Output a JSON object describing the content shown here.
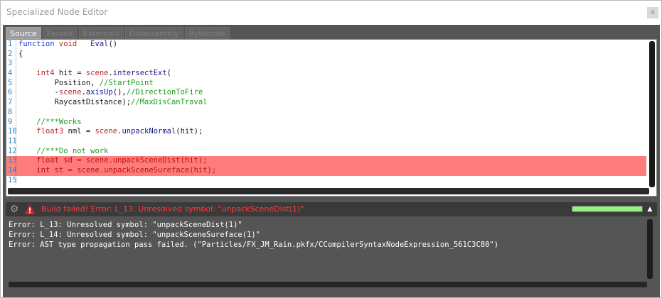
{
  "window": {
    "title": "Specialized Node Editor",
    "close_glyph": "x"
  },
  "tabs": [
    "Source",
    "Parsed",
    "Externals",
    "Disassembly",
    "Bytecode"
  ],
  "active_tab": "Source",
  "editor": {
    "lines": [
      {
        "n": "1",
        "tokens": [
          [
            "kw",
            "function "
          ],
          [
            "ty",
            "void"
          ],
          [
            "tx",
            "   "
          ],
          [
            "fn",
            "Eval"
          ],
          [
            "tx",
            "()"
          ]
        ]
      },
      {
        "n": "2",
        "tokens": [
          [
            "tx",
            "{"
          ]
        ]
      },
      {
        "n": "3",
        "tokens": []
      },
      {
        "n": "4",
        "tokens": [
          [
            "tx",
            "    "
          ],
          [
            "ty",
            "int4"
          ],
          [
            "tx",
            " hit = "
          ],
          [
            "ty",
            "scene"
          ],
          [
            "tx",
            "."
          ],
          [
            "fn",
            "intersectExt"
          ],
          [
            "tx",
            "("
          ]
        ]
      },
      {
        "n": "5",
        "tokens": [
          [
            "tx",
            "        Position, "
          ],
          [
            "cm",
            "//StartPoint"
          ]
        ]
      },
      {
        "n": "6",
        "tokens": [
          [
            "tx",
            "        -"
          ],
          [
            "ty",
            "scene"
          ],
          [
            "tx",
            "."
          ],
          [
            "fn",
            "axisUp"
          ],
          [
            "tx",
            "(),"
          ],
          [
            "cm",
            "//DirectionToFire"
          ]
        ]
      },
      {
        "n": "7",
        "tokens": [
          [
            "tx",
            "        RaycastDistance);"
          ],
          [
            "cm",
            "//MaxDisCanTraval"
          ]
        ]
      },
      {
        "n": "8",
        "tokens": []
      },
      {
        "n": "9",
        "tokens": [
          [
            "tx",
            "    "
          ],
          [
            "cm",
            "//***Works"
          ]
        ]
      },
      {
        "n": "10",
        "tokens": [
          [
            "tx",
            "    "
          ],
          [
            "ty",
            "float3"
          ],
          [
            "tx",
            " nml = "
          ],
          [
            "ty",
            "scene"
          ],
          [
            "tx",
            "."
          ],
          [
            "fn",
            "unpackNormal"
          ],
          [
            "tx",
            "(hit);"
          ]
        ]
      },
      {
        "n": "11",
        "tokens": []
      },
      {
        "n": "12",
        "tokens": [
          [
            "tx",
            "    "
          ],
          [
            "cm",
            "//***Do not work"
          ]
        ]
      },
      {
        "n": "13",
        "error": true,
        "tokens": [
          [
            "tx",
            "    "
          ],
          [
            "ty",
            "float"
          ],
          [
            "tx",
            " sd = "
          ],
          [
            "ty",
            "scene"
          ],
          [
            "tx",
            "."
          ],
          [
            "fn",
            "unpackSceneDist"
          ],
          [
            "tx",
            "(hit);"
          ]
        ]
      },
      {
        "n": "14",
        "error": true,
        "tokens": [
          [
            "tx",
            "    "
          ],
          [
            "ty",
            "int"
          ],
          [
            "tx",
            " st = "
          ],
          [
            "ty",
            "scene"
          ],
          [
            "tx",
            "."
          ],
          [
            "fn",
            "unpackSceneSureface"
          ],
          [
            "tx",
            "(hit);"
          ]
        ]
      },
      {
        "n": "15",
        "tokens": []
      }
    ]
  },
  "status": {
    "text": "Build failed! Error: L_13: Unresolved symbol: \"unpackSceneDist(1)\"",
    "gear_icon": "gear-icon",
    "warning_icon": "warning-icon",
    "progress": 1.0,
    "colors": {
      "error": "#ff3a3a",
      "progress": "#96f07e"
    }
  },
  "output": {
    "lines": [
      "Error: L_13: Unresolved symbol: \"unpackSceneDist(1)\"",
      "Error: L_14: Unresolved symbol: \"unpackSceneSureface(1)\"",
      "Error: AST type propagation pass failed. (\"Particles/FX_JM_Rain.pkfx/CCompilerSyntaxNodeExpression_561C3C80\")"
    ]
  }
}
